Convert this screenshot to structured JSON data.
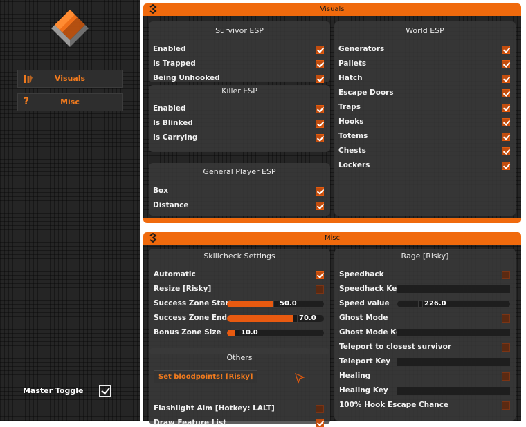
{
  "sidebar": {
    "nav": [
      {
        "label": "Visuals",
        "icon": "palette-icon"
      },
      {
        "label": "Misc",
        "icon": "question-icon",
        "glyph": "?"
      }
    ],
    "master_toggle": {
      "label": "Master Toggle",
      "checked": true
    }
  },
  "visuals": {
    "title": "Visuals",
    "survivor_esp": {
      "title": "Survivor ESP",
      "items": [
        {
          "label": "Enabled",
          "checked": true
        },
        {
          "label": "Is Trapped",
          "checked": true
        },
        {
          "label": "Being Unhooked",
          "checked": true
        }
      ]
    },
    "killer_esp": {
      "title": "Killer ESP",
      "items": [
        {
          "label": "Enabled",
          "checked": true
        },
        {
          "label": "Is Blinked",
          "checked": true
        },
        {
          "label": "Is Carrying",
          "checked": true
        }
      ]
    },
    "general_esp": {
      "title": "General Player ESP",
      "items": [
        {
          "label": "Box",
          "checked": true
        },
        {
          "label": "Distance",
          "checked": true
        }
      ]
    },
    "world_esp": {
      "title": "World ESP",
      "items": [
        {
          "label": "Generators",
          "checked": true
        },
        {
          "label": "Pallets",
          "checked": true
        },
        {
          "label": "Hatch",
          "checked": true
        },
        {
          "label": "Escape Doors",
          "checked": true
        },
        {
          "label": "Traps",
          "checked": true
        },
        {
          "label": "Hooks",
          "checked": true
        },
        {
          "label": "Totems",
          "checked": true
        },
        {
          "label": "Chests",
          "checked": true
        },
        {
          "label": "Lockers",
          "checked": true
        }
      ]
    }
  },
  "misc": {
    "title": "Misc",
    "skillcheck": {
      "title": "Skillcheck Settings",
      "automatic": {
        "label": "Automatic",
        "checked": true
      },
      "resize": {
        "label": "Resize [Risky]",
        "checked": false
      },
      "sliders": [
        {
          "label": "Success Zone Start",
          "value": "50.0",
          "fraction": 0.5
        },
        {
          "label": "Success Zone End",
          "value": "70.0",
          "fraction": 0.7
        },
        {
          "label": "Bonus Zone Size",
          "value": "10.0",
          "fraction": 0.1
        }
      ]
    },
    "others": {
      "title": "Others",
      "button_label": "Set bloodpoints! [Risky]",
      "flashlight": {
        "label": "Flashlight Aim [Hotkey: LALT]",
        "checked": false
      },
      "draw_features": {
        "label": "Draw Feature List",
        "checked": true
      }
    },
    "rage": {
      "title": "Rage [Risky]",
      "speedhack": {
        "label": "Speedhack",
        "checked": false
      },
      "speedhack_key": {
        "label": "Speedhack Key",
        "value": ""
      },
      "speed_value": {
        "label": "Speed value",
        "value": "226.0",
        "fraction": 0.2
      },
      "ghost_mode": {
        "label": "Ghost Mode",
        "checked": false
      },
      "ghost_mode_key": {
        "label": "Ghost Mode Key",
        "value": ""
      },
      "teleport": {
        "label": "Teleport to closest survivor",
        "checked": false
      },
      "teleport_key": {
        "label": "Teleport Key",
        "value": ""
      },
      "healing": {
        "label": "Healing",
        "checked": false
      },
      "healing_key": {
        "label": "Healing Key",
        "value": ""
      },
      "hook_escape": {
        "label": "100% Hook Escape Chance",
        "checked": false
      }
    }
  },
  "colors": {
    "accent": "#f06a0d",
    "panel": "#3a3a3a",
    "background": "#252525"
  }
}
